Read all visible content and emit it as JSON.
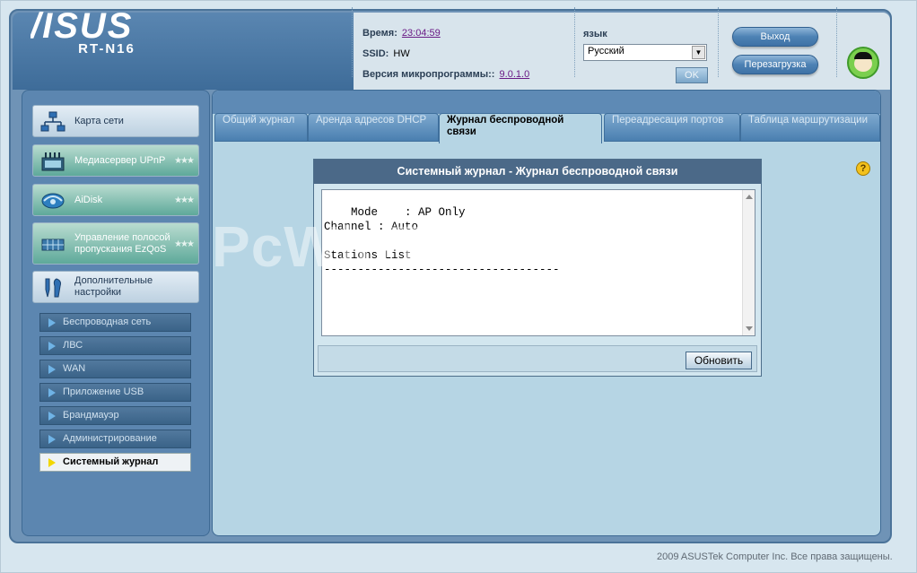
{
  "brand": {
    "logo_text": "/ISUS",
    "model": "RT-N16"
  },
  "status": {
    "time_label": "Время:",
    "time_value": "23:04:59",
    "ssid_label": "SSID:",
    "ssid_value": "HW",
    "firmware_label": "Версия микропрограммы::",
    "firmware_value": "9.0.1.0"
  },
  "language": {
    "label": "язык",
    "selected": "Русский",
    "ok_label": "OK"
  },
  "actions": {
    "logout": "Выход",
    "reboot": "Перезагрузка"
  },
  "sidebar": {
    "main_items": [
      {
        "label": "Карта сети",
        "icon": "network-map-icon",
        "stars": ""
      },
      {
        "label": "Медиасервер UPnP",
        "icon": "media-server-icon",
        "stars": "★★★"
      },
      {
        "label": "AiDisk",
        "icon": "aidisk-icon",
        "stars": "★★★"
      },
      {
        "label": "Управление полосой пропускания EzQoS",
        "icon": "ezqos-icon",
        "stars": "★★★"
      },
      {
        "label": "Дополнительные настройки",
        "icon": "wrench-icon",
        "stars": ""
      }
    ],
    "sub_items": [
      {
        "label": "Беспроводная сеть"
      },
      {
        "label": "ЛВС"
      },
      {
        "label": "WAN"
      },
      {
        "label": "Приложение USB"
      },
      {
        "label": "Брандмауэр"
      },
      {
        "label": "Администрирование"
      },
      {
        "label": "Системный журнал"
      }
    ]
  },
  "tabs": [
    {
      "label": "Общий журнал"
    },
    {
      "label": "Аренда адресов DHCP"
    },
    {
      "label": "Журнал беспроводной связи"
    },
    {
      "label": "Переадресация портов"
    },
    {
      "label": "Таблица маршрутизации"
    }
  ],
  "panel": {
    "title": "Системный журнал - Журнал беспроводной связи",
    "log_text": "Mode    : AP Only\nChannel : Auto\n\nStations List\n-----------------------------------",
    "refresh_label": "Обновить"
  },
  "watermark": "PcWinTech.com",
  "footer": {
    "copyright": "2009 ASUSTek Computer Inc. Все права защищены."
  },
  "colors": {
    "frame_blue": "#6f93b6",
    "panel_header": "#4b6988",
    "teal_item": "#5ea99a",
    "active_marker": "#f2d700"
  }
}
